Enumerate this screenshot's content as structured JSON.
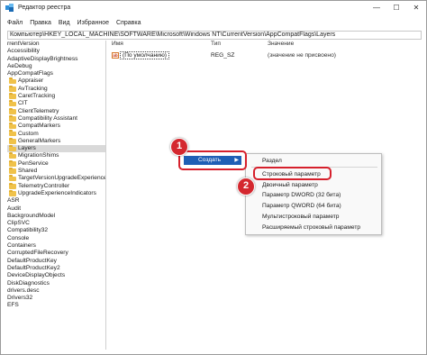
{
  "window": {
    "title": "Редактор реестра",
    "controls": {
      "minimize": "—",
      "maximize": "☐",
      "close": "✕"
    }
  },
  "menu": [
    "Файл",
    "Правка",
    "Вид",
    "Избранное",
    "Справка"
  ],
  "address": "Компьютер\\HKEY_LOCAL_MACHINE\\SOFTWARE\\Microsoft\\Windows NT\\CurrentVersion\\AppCompatFlags\\Layers",
  "tree": {
    "items": [
      {
        "label": "rrentVersion",
        "folder": false
      },
      {
        "label": "Accessibility",
        "folder": false
      },
      {
        "label": "AdaptiveDisplayBrightness",
        "folder": false
      },
      {
        "label": "AeDebug",
        "folder": false
      },
      {
        "label": "AppCompatFlags",
        "folder": false
      },
      {
        "label": "Appraiser",
        "folder": true
      },
      {
        "label": "AvTracking",
        "folder": true
      },
      {
        "label": "CaretTracking",
        "folder": true
      },
      {
        "label": "CIT",
        "folder": true
      },
      {
        "label": "ClientTelemetry",
        "folder": true
      },
      {
        "label": "Compatibility Assistant",
        "folder": true
      },
      {
        "label": "CompatMarkers",
        "folder": true
      },
      {
        "label": "Custom",
        "folder": true
      },
      {
        "label": "GeneralMarkers",
        "folder": true
      },
      {
        "label": "Layers",
        "folder": true,
        "selected": true
      },
      {
        "label": "MigrationShims",
        "folder": true
      },
      {
        "label": "PenService",
        "folder": true
      },
      {
        "label": "Shared",
        "folder": true
      },
      {
        "label": "TargetVersionUpgradeExperienceI",
        "folder": true
      },
      {
        "label": "TelemetryController",
        "folder": true
      },
      {
        "label": "UpgradeExperienceIndicators",
        "folder": true
      },
      {
        "label": "ASR",
        "folder": false
      },
      {
        "label": "Audit",
        "folder": false
      },
      {
        "label": "BackgroundModel",
        "folder": false
      },
      {
        "label": "ClipSVC",
        "folder": false
      },
      {
        "label": "Compatibility32",
        "folder": false
      },
      {
        "label": "Console",
        "folder": false
      },
      {
        "label": "Containers",
        "folder": false
      },
      {
        "label": "CorruptedFileRecovery",
        "folder": false
      },
      {
        "label": "DefaultProductKey",
        "folder": false
      },
      {
        "label": "DefaultProductKey2",
        "folder": false
      },
      {
        "label": "DeviceDisplayObjects",
        "folder": false
      },
      {
        "label": "DiskDiagnostics",
        "folder": false
      },
      {
        "label": "drivers.desc",
        "folder": false
      },
      {
        "label": "Drivers32",
        "folder": false
      },
      {
        "label": "EFS",
        "folder": false
      }
    ]
  },
  "values": {
    "headers": {
      "name": "Имя",
      "type": "Тип",
      "data": "Значение"
    },
    "rows": [
      {
        "icon": "string-value-icon",
        "icon_text": "ab",
        "name": "(По умолчанию)",
        "type": "REG_SZ",
        "data": "(значение не присвоено)"
      }
    ]
  },
  "context_menu": {
    "parent": {
      "label": "Создать",
      "arrow": "▶"
    },
    "submenu": [
      "Раздел",
      "Строковый параметр",
      "Двоичный параметр",
      "Параметр DWORD (32 бита)",
      "Параметр QWORD (64 бита)",
      "Мультистроковый параметр",
      "Расширяемый строковый параметр"
    ]
  },
  "annotations": {
    "step1": "1",
    "step2": "2",
    "highlight_color": "#d6202c"
  },
  "colors": {
    "menu_selected": "#1f5fb5",
    "folder": "#f0c24a",
    "badge": "#d4282f"
  }
}
